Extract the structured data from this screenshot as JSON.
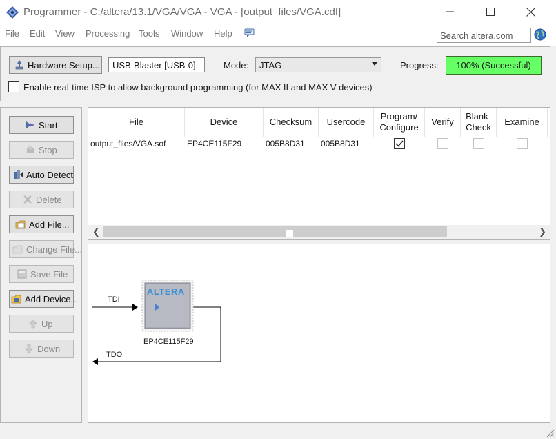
{
  "window": {
    "title": "Programmer - C:/altera/13.1/VGA/VGA - VGA - [output_files/VGA.cdf]",
    "min_icon": "minimize-icon",
    "max_icon": "maximize-icon",
    "close_icon": "close-icon"
  },
  "menu": {
    "items": [
      "File",
      "Edit",
      "View",
      "Processing",
      "Tools",
      "Window",
      "Help"
    ],
    "help_icon": "message-icon",
    "search_placeholder": "Search altera.com",
    "globe_icon": "globe-icon"
  },
  "toolbar": {
    "hardware_setup_label": "Hardware Setup...",
    "hardware_value": "USB-Blaster [USB-0]",
    "mode_label": "Mode:",
    "mode_value": "JTAG",
    "progress_label": "Progress:",
    "progress_value": "100% (Successful)",
    "progress_percent": 100,
    "isp_label": "Enable real-time ISP to allow background programming (for MAX II and MAX V devices)",
    "isp_checked": false
  },
  "side_buttons": [
    {
      "label": "Start",
      "enabled": true,
      "icon": "start-icon"
    },
    {
      "label": "Stop",
      "enabled": false,
      "icon": "stop-icon"
    },
    {
      "label": "Auto Detect",
      "enabled": true,
      "icon": "auto-detect-icon"
    },
    {
      "label": "Delete",
      "enabled": false,
      "icon": "delete-icon"
    },
    {
      "label": "Add File...",
      "enabled": true,
      "icon": "add-file-icon"
    },
    {
      "label": "Change File...",
      "enabled": false,
      "icon": "change-file-icon"
    },
    {
      "label": "Save File",
      "enabled": false,
      "icon": "save-file-icon"
    },
    {
      "label": "Add Device...",
      "enabled": true,
      "icon": "add-device-icon"
    },
    {
      "label": "Up",
      "enabled": false,
      "icon": "up-icon"
    },
    {
      "label": "Down",
      "enabled": false,
      "icon": "down-icon"
    }
  ],
  "table": {
    "columns": [
      "File",
      "Device",
      "Checksum",
      "Usercode",
      "Program/ Configure",
      "Verify",
      "Blank- Check",
      "Examine"
    ],
    "rows": [
      {
        "file": "output_files/VGA.sof",
        "device": "EP4CE115F29",
        "checksum": "005B8D31",
        "usercode": "005B8D31",
        "program_configure": true,
        "verify": false,
        "blank_check": false,
        "examine": false
      }
    ]
  },
  "diagram": {
    "tdi_label": "TDI",
    "tdo_label": "TDO",
    "chip_logo": "ALTERA",
    "chip_name": "EP4CE115F29"
  }
}
